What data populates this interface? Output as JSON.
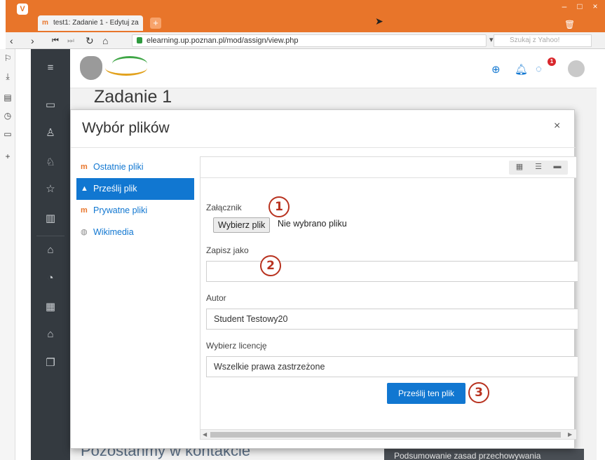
{
  "browser": {
    "tab_title": "test1: Zadanie 1 - Edytuj za",
    "url": "elearning.up.poznan.pl/mod/assign/view.php",
    "search_placeholder": "Szukaj z Yahoo!",
    "new_tab": "+",
    "minimize": "–",
    "maximize": "□",
    "close": "×"
  },
  "header": {
    "notification_count": "1"
  },
  "page": {
    "title": "Zadanie 1",
    "footer_heading": "Pozostańmy w kontakcie",
    "footer_link": "Podsumowanie zasad przechowywania"
  },
  "modal": {
    "title": "Wybór plików",
    "close": "×",
    "repositories": [
      {
        "label": "Ostatnie pliki",
        "icon": "moodle-icon"
      },
      {
        "label": "Prześlij plik",
        "icon": "upload-icon",
        "active": true
      },
      {
        "label": "Prywatne pliki",
        "icon": "moodle-icon"
      },
      {
        "label": "Wikimedia",
        "icon": "wikimedia-icon"
      }
    ],
    "form": {
      "attachment_label": "Załącznik",
      "choose_file_button": "Wybierz plik",
      "no_file_text": "Nie wybrano pliku",
      "save_as_label": "Zapisz jako",
      "save_as_value": "",
      "author_label": "Autor",
      "author_value": "Student Testowy20",
      "license_label": "Wybierz licencję",
      "license_value": "Wszelkie prawa zastrzeżone",
      "submit_button": "Prześlij ten plik"
    }
  },
  "annotations": [
    "1",
    "2",
    "3"
  ],
  "colors": {
    "browser_accent": "#e8752a",
    "moodle_blue": "#1177d1",
    "sidebar_dark": "#343a40",
    "annotation_red": "#b8321f"
  }
}
